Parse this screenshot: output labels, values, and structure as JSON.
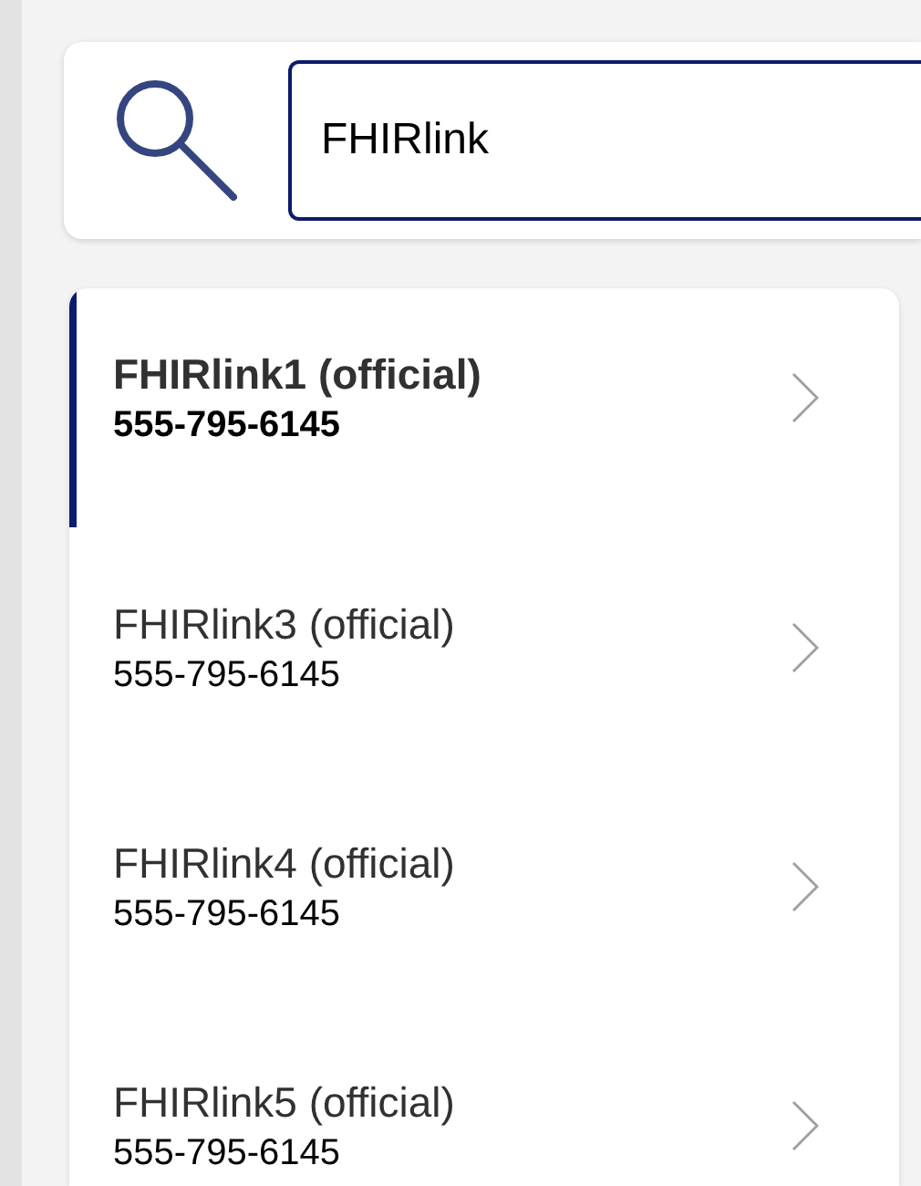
{
  "search": {
    "value": "FHIRlink"
  },
  "results": [
    {
      "name": "FHIRlink1 (official)",
      "phone": "555-795-6145",
      "selected": true
    },
    {
      "name": "FHIRlink3 (official)",
      "phone": "555-795-6145",
      "selected": false
    },
    {
      "name": "FHIRlink4 (official)",
      "phone": "555-795-6145",
      "selected": false
    },
    {
      "name": "FHIRlink5 (official)",
      "phone": "555-795-6145",
      "selected": false
    }
  ]
}
